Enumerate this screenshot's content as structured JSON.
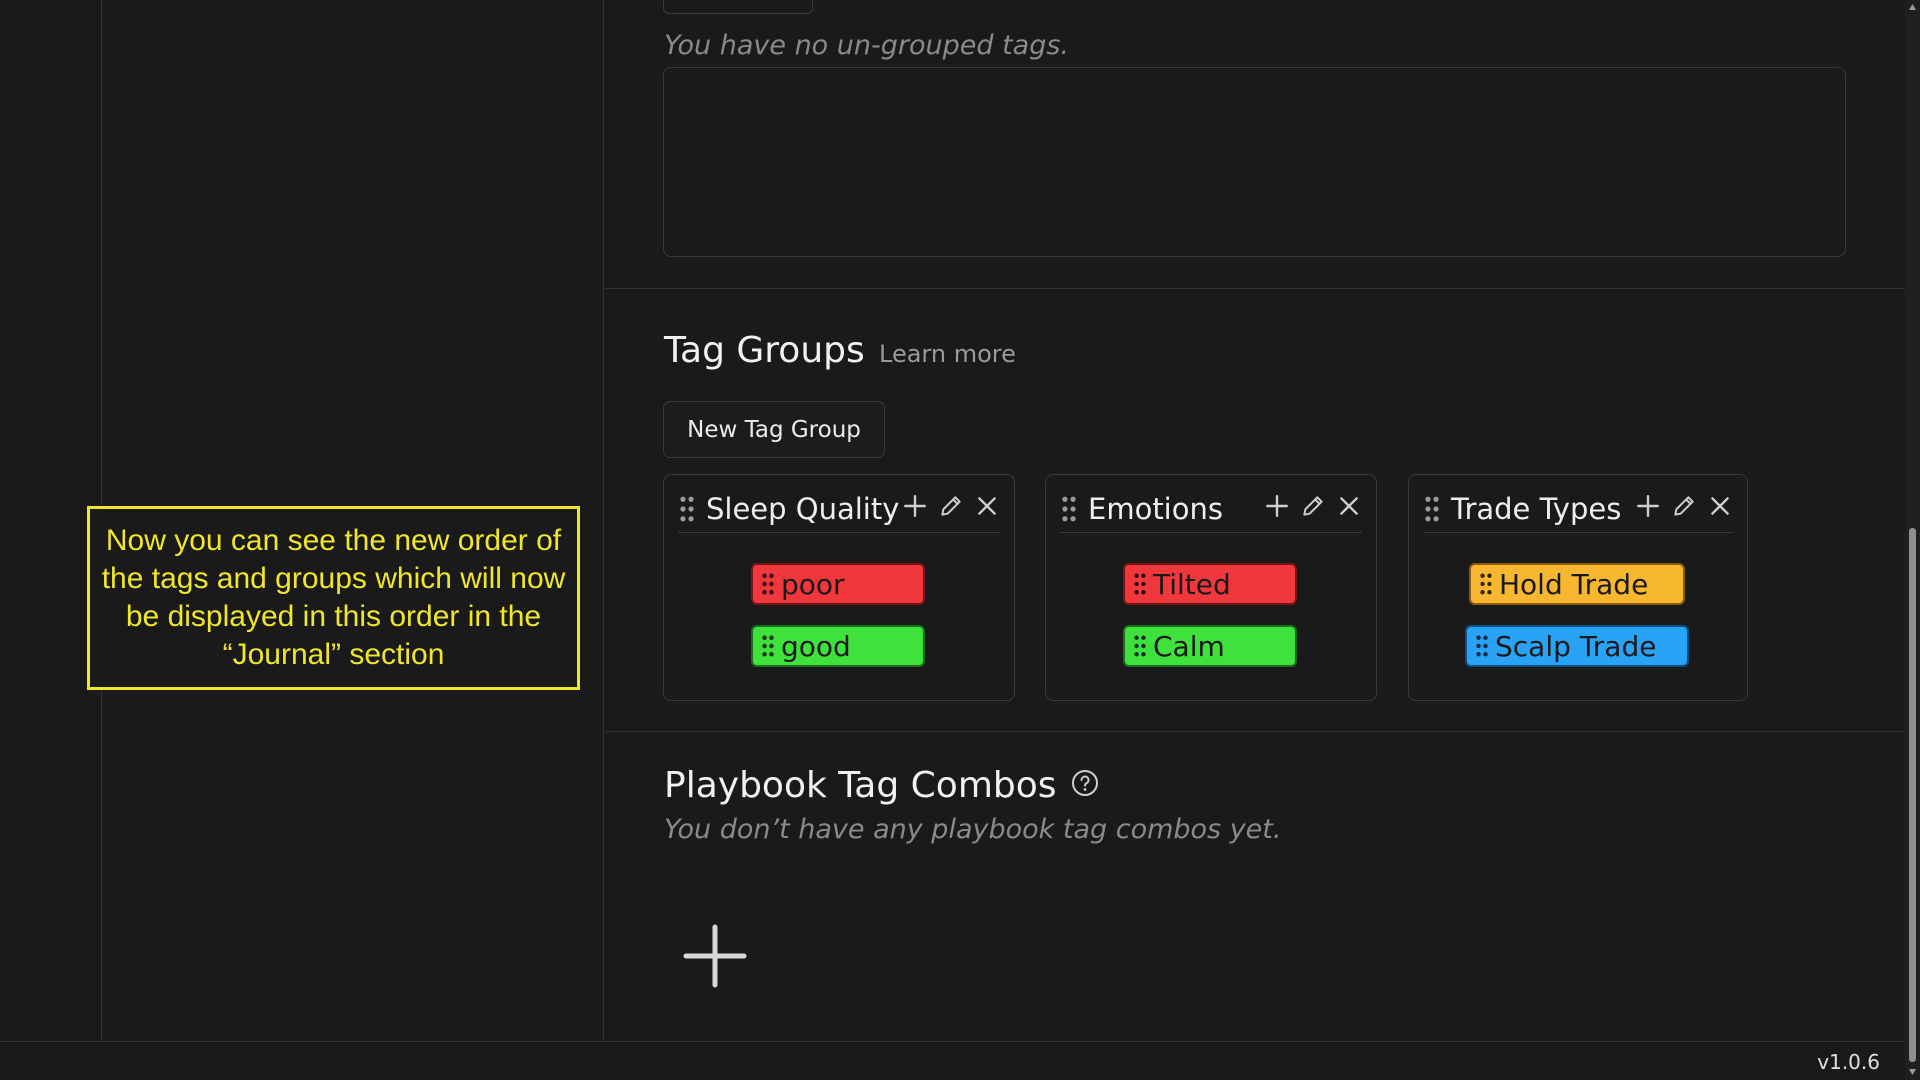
{
  "callout": {
    "text": "Now you can see the new order of the tags and groups which will now be displayed in this order in the “Journal” section"
  },
  "ungrouped": {
    "empty_text": "You have no un-grouped tags."
  },
  "tag_groups": {
    "title": "Tag Groups",
    "learn_more": "Learn more",
    "new_button": "New Tag Group",
    "groups": [
      {
        "name": "Sleep Quality",
        "tags": [
          {
            "label": "poor",
            "color": "#f0373c"
          },
          {
            "label": "good",
            "color": "#3fe23d"
          }
        ]
      },
      {
        "name": "Emotions",
        "tags": [
          {
            "label": "Tilted",
            "color": "#f0373c"
          },
          {
            "label": "Calm",
            "color": "#3fe23d"
          }
        ]
      },
      {
        "name": "Trade Types",
        "tags": [
          {
            "label": "Hold Trade",
            "color": "#f7b731"
          },
          {
            "label": "Scalp Trade",
            "color": "#29a3f5"
          }
        ]
      }
    ]
  },
  "playbook": {
    "title": "Playbook Tag Combos",
    "empty_text": "You don’t have any playbook tag combos yet."
  },
  "footer": {
    "version": "v1.0.6"
  }
}
